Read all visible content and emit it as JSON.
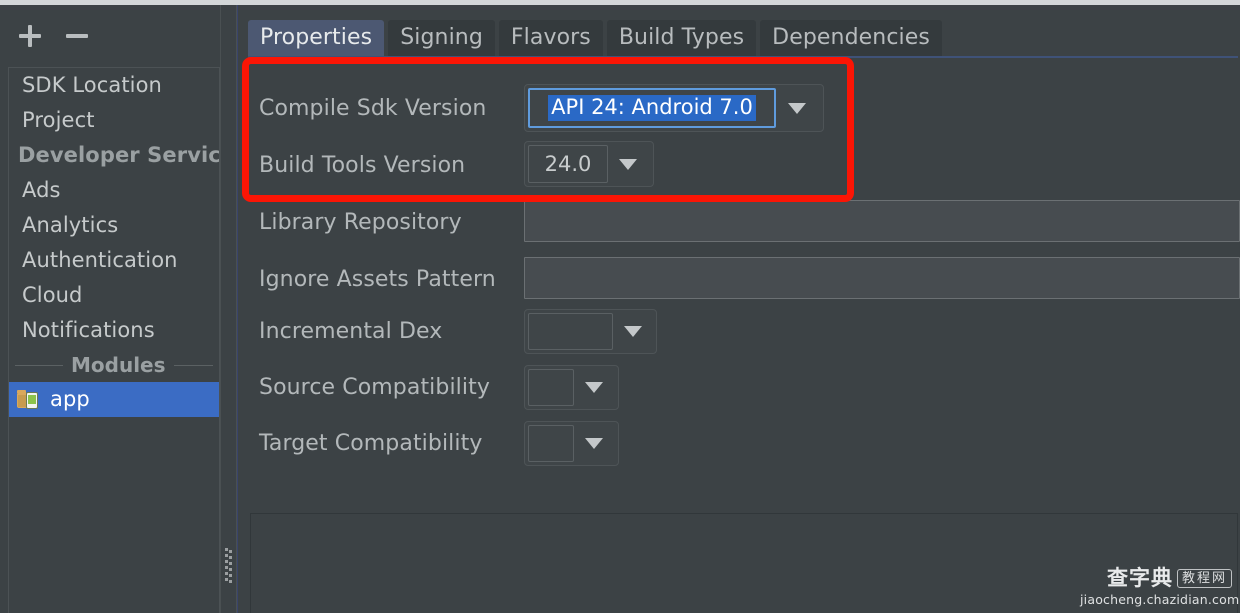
{
  "sidebar": {
    "toolbar": {
      "add_label": "+",
      "remove_label": "−"
    },
    "items": [
      {
        "label": "SDK Location",
        "type": "item"
      },
      {
        "label": "Project",
        "type": "item"
      },
      {
        "label": "Developer Services",
        "type": "group"
      },
      {
        "label": "Ads",
        "type": "item"
      },
      {
        "label": "Analytics",
        "type": "item"
      },
      {
        "label": "Authentication",
        "type": "item"
      },
      {
        "label": "Cloud",
        "type": "item"
      },
      {
        "label": "Notifications",
        "type": "item"
      }
    ],
    "modules_separator_label": "Modules",
    "selected_module": "app"
  },
  "main": {
    "tabs": [
      {
        "label": "Properties",
        "active": true
      },
      {
        "label": "Signing",
        "active": false
      },
      {
        "label": "Flavors",
        "active": false
      },
      {
        "label": "Build Types",
        "active": false
      },
      {
        "label": "Dependencies",
        "active": false
      }
    ],
    "fields": [
      {
        "label": "Compile Sdk Version",
        "value": "API 24: Android 7.0",
        "control": "combo-editable-focused"
      },
      {
        "label": "Build Tools Version",
        "value": "24.0",
        "control": "combo"
      },
      {
        "label": "Library Repository",
        "value": "",
        "control": "textfield"
      },
      {
        "label": "Ignore Assets Pattern",
        "value": "",
        "control": "textfield"
      },
      {
        "label": "Incremental Dex",
        "value": "",
        "control": "combo-wide"
      },
      {
        "label": "Source Compatibility",
        "value": "",
        "control": "combo-small"
      },
      {
        "label": "Target Compatibility",
        "value": "",
        "control": "combo-small"
      }
    ]
  },
  "colors": {
    "background": "#3c4245",
    "selection_blue": "#3b6cc4",
    "active_tab": "#4c5872",
    "annotation_red": "#fb1505",
    "text_selection": "#2a69c6"
  },
  "watermark": {
    "brand": "查字典",
    "badge": "教程网",
    "url": "jiaocheng.chazidian.com"
  }
}
